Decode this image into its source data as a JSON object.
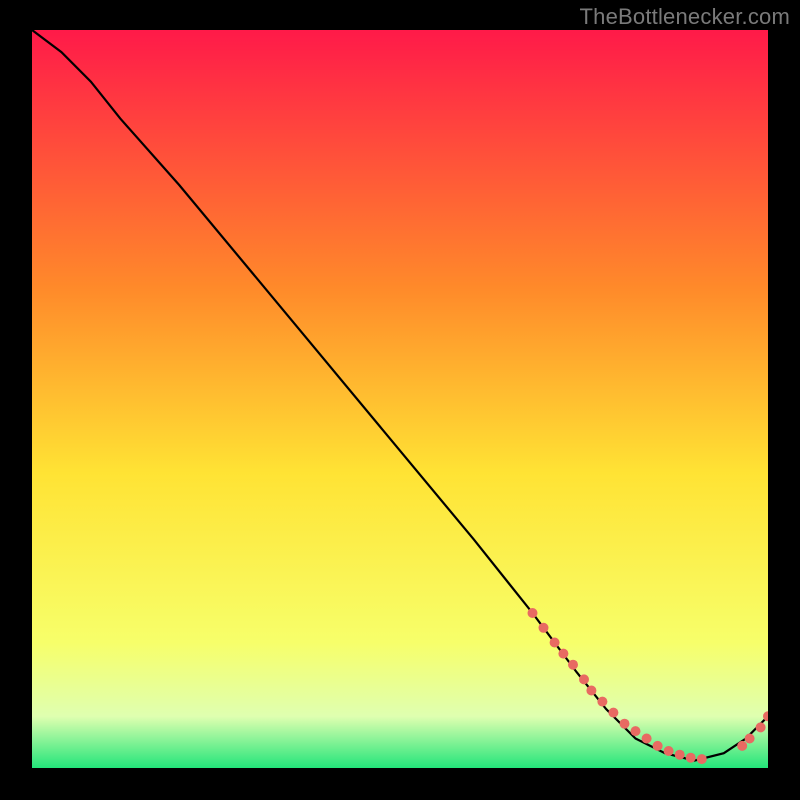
{
  "watermark": "TheBottlenecker.com",
  "colors": {
    "bg": "#000000",
    "curve": "#000000",
    "marker": "#e86a62",
    "grad_top": "#ff1a49",
    "grad_mid_top": "#ff8a2a",
    "grad_mid": "#ffe334",
    "grad_low": "#f7ff6a",
    "grad_pale": "#dfffb0",
    "grad_bottom": "#23e57a"
  },
  "chart_data": {
    "type": "line",
    "title": "",
    "xlabel": "",
    "ylabel": "",
    "xlim": [
      0,
      100
    ],
    "ylim": [
      0,
      100
    ],
    "series": [
      {
        "name": "curve",
        "x": [
          0,
          4,
          8,
          12,
          20,
          30,
          40,
          50,
          60,
          68,
          74,
          78,
          82,
          86,
          90,
          94,
          97,
          100
        ],
        "y": [
          100,
          97,
          93,
          88,
          79,
          67,
          55,
          43,
          31,
          21,
          13,
          8,
          4,
          2,
          1,
          2,
          4,
          7
        ]
      }
    ],
    "markers": {
      "name": "highlight-points",
      "x": [
        68,
        69.5,
        71,
        72.2,
        73.5,
        75,
        76,
        77.5,
        79,
        80.5,
        82,
        83.5,
        85,
        86.5,
        88,
        89.5,
        91,
        96.5,
        97.5,
        99,
        100
      ],
      "y": [
        21,
        19,
        17,
        15.5,
        14,
        12,
        10.5,
        9,
        7.5,
        6,
        5,
        4,
        3,
        2.3,
        1.8,
        1.4,
        1.2,
        3,
        4,
        5.5,
        7
      ]
    }
  }
}
